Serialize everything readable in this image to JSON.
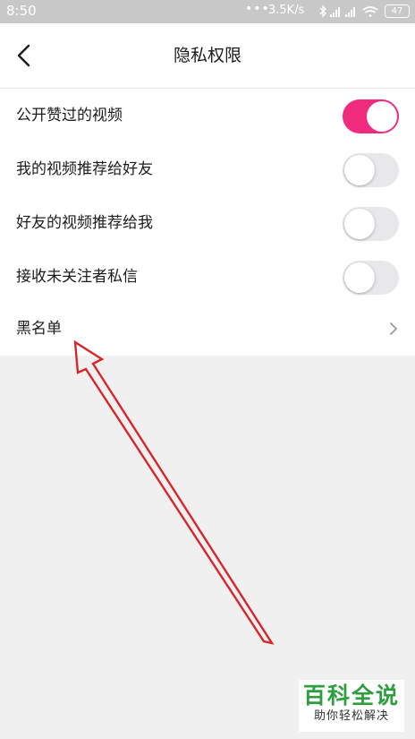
{
  "status_bar": {
    "time": "8:50",
    "dots": "•••",
    "network_speed": "3.5K/s",
    "battery": "47"
  },
  "header": {
    "back_icon": "chevron-left-icon",
    "title": "隐私权限"
  },
  "settings": [
    {
      "label": "公开赞过的视频",
      "control": "toggle",
      "on": true
    },
    {
      "label": "我的视频推荐给好友",
      "control": "toggle",
      "on": false
    },
    {
      "label": "好友的视频推荐给我",
      "control": "toggle",
      "on": false
    },
    {
      "label": "接收未关注者私信",
      "control": "toggle",
      "on": false
    },
    {
      "label": "黑名单",
      "control": "chevron-right-icon"
    }
  ],
  "colors": {
    "toggle_on": "#f02b7e",
    "toggle_off": "#e8e8ea",
    "annotation_arrow": "#d6262b",
    "watermark_green": "#2f9e3f"
  },
  "watermark": {
    "logo": "百科全说",
    "tagline": "助你轻松解决"
  }
}
